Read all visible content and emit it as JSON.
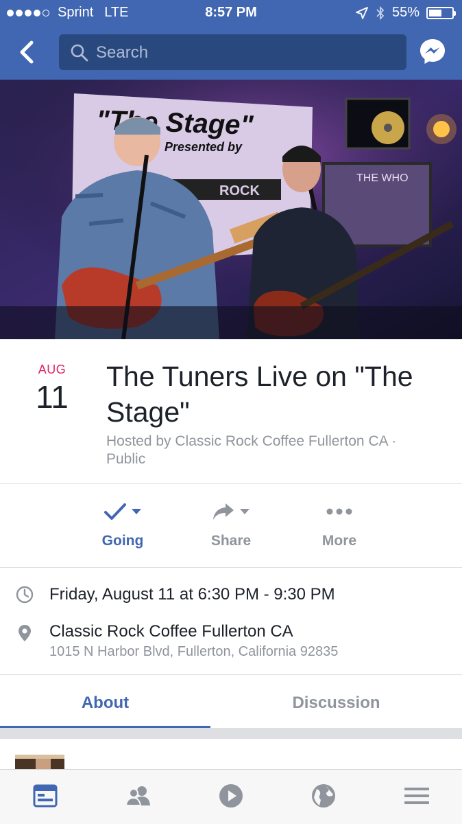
{
  "status_bar": {
    "carrier": "Sprint",
    "network": "LTE",
    "time": "8:57 PM",
    "battery": "55%",
    "battery_level": 0.55
  },
  "header": {
    "search_placeholder": "Search",
    "back_icon": "chevron-left-icon",
    "messenger_icon": "messenger-icon"
  },
  "cover_photo": {
    "banner_lines": [
      "\"The Stage\"",
      "Presented by",
      "ROCK"
    ],
    "poster_text": "THE WHO"
  },
  "event": {
    "month": "AUG",
    "day": "11",
    "title": "The Tuners Live on \"The Stage\"",
    "host": "Hosted by Classic Rock Coffee Fullerton CA · Public"
  },
  "actions": [
    {
      "label": "Going",
      "icon": "check-icon"
    },
    {
      "label": "Share",
      "icon": "share-arrow-icon"
    },
    {
      "label": "More",
      "icon": "more-dots-icon"
    }
  ],
  "details": {
    "time": "Friday, August 11 at 6:30 PM - 9:30 PM",
    "venue": "Classic Rock Coffee Fullerton CA",
    "address": "1015 N Harbor Blvd, Fullerton, California 92835"
  },
  "tabs": {
    "about": "About",
    "discussion": "Discussion"
  },
  "bottom_nav": [
    "news-feed-icon",
    "friends-icon",
    "video-icon",
    "globe-icon",
    "menu-icon"
  ],
  "colors": {
    "brand_blue": "#4267b2",
    "date_red": "#e0245e",
    "gray_text": "#90949c"
  }
}
